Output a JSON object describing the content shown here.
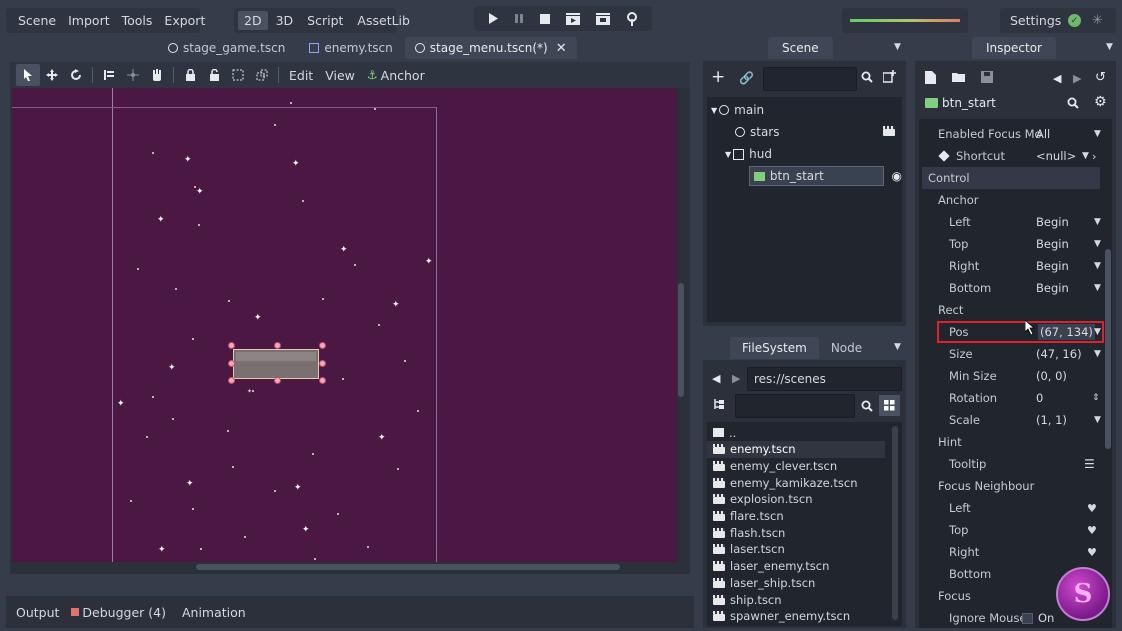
{
  "menu": [
    "Scene",
    "Import",
    "Tools",
    "Export"
  ],
  "workspaces": [
    "2D",
    "3D",
    "Script",
    "AssetLib"
  ],
  "active_workspace": "2D",
  "settings_label": "Settings",
  "scene_tabs": [
    "stage_game.tscn",
    "enemy.tscn",
    "stage_menu.tscn(*)"
  ],
  "active_scene_tab": "stage_menu.tscn(*)",
  "toolbar": {
    "edit": "Edit",
    "view": "View",
    "anchor": "Anchor"
  },
  "scene_dock": {
    "title": "Scene",
    "tree": [
      {
        "label": "main",
        "icon": "node-circle-icon",
        "depth": 0
      },
      {
        "label": "stars",
        "icon": "node-circle-icon",
        "depth": 1
      },
      {
        "label": "hud",
        "icon": "control-icon",
        "depth": 1
      },
      {
        "label": "btn_start",
        "icon": "texture-button-icon",
        "depth": 2
      }
    ]
  },
  "filesystem": {
    "tabs": [
      "FileSystem",
      "Node"
    ],
    "path": "res://scenes",
    "files": [
      "..",
      "enemy.tscn",
      "enemy_clever.tscn",
      "enemy_kamikaze.tscn",
      "explosion.tscn",
      "flare.tscn",
      "flash.tscn",
      "laser.tscn",
      "laser_enemy.tscn",
      "laser_ship.tscn",
      "ship.tscn",
      "spawner_enemy.tscn"
    ],
    "selected": "enemy.tscn"
  },
  "inspector": {
    "title": "Inspector",
    "node_name": "btn_start",
    "rows": [
      {
        "type": "prop",
        "label": "Enabled Focus Mo",
        "value": "All",
        "indent": 1
      },
      {
        "type": "prop",
        "label": "Shortcut",
        "value": "<null>",
        "indent": 2,
        "icon": "cube-icon"
      },
      {
        "type": "section",
        "label": "Control"
      },
      {
        "type": "sub",
        "label": "Anchor"
      },
      {
        "type": "prop",
        "label": "Left",
        "value": "Begin",
        "indent": 2
      },
      {
        "type": "prop",
        "label": "Top",
        "value": "Begin",
        "indent": 2
      },
      {
        "type": "prop",
        "label": "Right",
        "value": "Begin",
        "indent": 2
      },
      {
        "type": "prop",
        "label": "Bottom",
        "value": "Begin",
        "indent": 2
      },
      {
        "type": "sub",
        "label": "Rect"
      },
      {
        "type": "prop",
        "label": "Pos",
        "value": "(67, 134)",
        "indent": 2,
        "highlight": true
      },
      {
        "type": "prop",
        "label": "Size",
        "value": "(47, 16)",
        "indent": 2
      },
      {
        "type": "prop",
        "label": "Min Size",
        "value": "(0, 0)",
        "indent": 2
      },
      {
        "type": "prop",
        "label": "Rotation",
        "value": "0",
        "indent": 2
      },
      {
        "type": "prop",
        "label": "Scale",
        "value": "(1, 1)",
        "indent": 2
      },
      {
        "type": "sub",
        "label": "Hint"
      },
      {
        "type": "prop",
        "label": "Tooltip",
        "value": "",
        "indent": 2
      },
      {
        "type": "sub",
        "label": "Focus Neighbour"
      },
      {
        "type": "prop",
        "label": "Left",
        "value": "",
        "indent": 2
      },
      {
        "type": "prop",
        "label": "Top",
        "value": "",
        "indent": 2
      },
      {
        "type": "prop",
        "label": "Right",
        "value": "",
        "indent": 2
      },
      {
        "type": "prop",
        "label": "Bottom",
        "value": "",
        "indent": 2
      },
      {
        "type": "sub",
        "label": "Focus"
      },
      {
        "type": "prop",
        "label": "Ignore Mouse",
        "value": "On",
        "indent": 2
      }
    ]
  },
  "bottom_tabs": [
    "Output",
    "Debugger (4)",
    "Animation"
  ],
  "colors": {
    "accent": "#6bd66b",
    "viewport_bg": "#4a1842",
    "highlight_box": "#e0202a"
  }
}
